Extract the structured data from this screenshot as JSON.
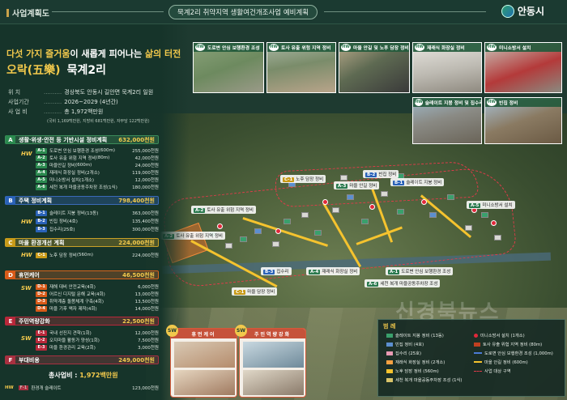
{
  "header": {
    "section": "사업계획도",
    "badge": "묵계2리 취약지역 생활여건개조사업 예비계획",
    "logo_text": "안동시"
  },
  "headline": {
    "line1_pre": "다섯 가지 즐거움",
    "line1_mid": "이 새롭게 피어나는 ",
    "line1_em": "삶의 터전",
    "orak": "오락(五樂)",
    "village": "묵계2리"
  },
  "project_info": [
    {
      "key": "위 치",
      "value": "경상북도 안동시 길안면 묵계2리 일원"
    },
    {
      "key": "사업기간",
      "value": "2026~2029 (4년간)"
    },
    {
      "key": "사 업 비",
      "value": "총 1,972백만원"
    }
  ],
  "funding_note": "(국비 1,169백만원, 지방비 681백만원, 자부담 122백만원)",
  "categories": [
    {
      "code": "A",
      "name": "생활·위생·안전 등 기반시설 정비계획",
      "amount": "632,000천원"
    },
    {
      "code": "B",
      "name": "주택 정비계획",
      "amount": "798,400천원"
    },
    {
      "code": "C",
      "name": "마을 환경개선 계획",
      "amount": "224,000천원"
    },
    {
      "code": "D",
      "name": "휴먼케어",
      "amount": "46,500천원"
    },
    {
      "code": "E",
      "name": "주민역량강화",
      "amount": "22,500천원"
    },
    {
      "code": "F",
      "name": "부대비용",
      "amount": "249,000천원"
    }
  ],
  "items_a": [
    {
      "code": "A-1",
      "name": "도로변 안심 보행환경 조성",
      "unit": "(600m)",
      "amount": "255,000천원"
    },
    {
      "code": "A-2",
      "name": "토사 유출 위험 지역 정비",
      "unit": "(80m)",
      "amount": "42,000천원"
    },
    {
      "code": "A-3",
      "name": "마을안길 정비",
      "unit": "(600m)",
      "amount": "24,000천원"
    },
    {
      "code": "A-4",
      "name": "재래식 화장실 정비",
      "unit": "(2개소)",
      "amount": "119,000천원"
    },
    {
      "code": "A-5",
      "name": "미니소방서 설치",
      "unit": "(1개소)",
      "amount": "12,000천원"
    },
    {
      "code": "A-6",
      "name": "세천 복개 마을공동주차장 조성",
      "unit": "(1식)",
      "amount": "180,000천원"
    }
  ],
  "items_b": [
    {
      "code": "B-1",
      "name": "슬레이트 지붕 정비",
      "unit": "(13동)",
      "amount": "363,000천원"
    },
    {
      "code": "B-2",
      "name": "빈집 정비",
      "unit": "(4호)",
      "amount": "135,400천원"
    },
    {
      "code": "B-3",
      "name": "집수리",
      "unit": "(25호)",
      "amount": "300,000천원"
    }
  ],
  "items_c": [
    {
      "code": "C-1",
      "name": "노후 담장 정비",
      "unit": "(560m)",
      "amount": "224,000천원"
    }
  ],
  "items_d": [
    {
      "code": "D-1",
      "name": "재해 대비 안전교육",
      "unit": "(4회)",
      "amount": "6,000천원"
    },
    {
      "code": "D-2",
      "name": "어르신 디지털 문해 교육",
      "unit": "(4회)",
      "amount": "13,000천원"
    },
    {
      "code": "D-3",
      "name": "취약계층 돌봄체계 구축",
      "unit": "(4회)",
      "amount": "13,500천원"
    },
    {
      "code": "D-4",
      "name": "마을 기후 액자 제작",
      "unit": "(4회)",
      "amount": "14,000천원"
    }
  ],
  "items_e": [
    {
      "code": "E-1",
      "name": "국내 선진지 견학",
      "unit": "(1회)",
      "amount": "12,000천원"
    },
    {
      "code": "E-2",
      "name": "오지마을 활동가 양성",
      "unit": "(1회)",
      "amount": "7,500천원"
    },
    {
      "code": "E-3",
      "name": "마을 환경관리 교육",
      "unit": "(2회)",
      "amount": "3,000천원"
    }
  ],
  "total_label": "총사업비 : ",
  "total_value": "1,972백만원",
  "extra_row": {
    "tag": "HW",
    "code": "F-1",
    "name": "환경개 슬레이트",
    "amount": "123,000천원"
  },
  "side_tags": {
    "hw": "HW",
    "sw": "SW"
  },
  "photos": [
    {
      "tag": "HW",
      "label": "도로변 안심 보행환경 조성"
    },
    {
      "tag": "HW",
      "label": "토사 유출 위험 지역 정비"
    },
    {
      "tag": "HW",
      "label": "마을 안길 및 노후 담장 정비"
    },
    {
      "tag": "HW",
      "label": "재래식 화장실 정비"
    },
    {
      "tag": "HW",
      "label": "미니소방서 설치"
    },
    {
      "tag": "HW",
      "label": "슬레이트 지붕 정비 및 집수리"
    },
    {
      "tag": "HW",
      "label": "빈집 정비"
    }
  ],
  "sw_boxes": [
    {
      "tag": "SW",
      "label": "휴먼케어"
    },
    {
      "tag": "SW",
      "label": "주민역량강화"
    }
  ],
  "map_labels": {
    "a1": "도로변 안심 보행환경 조성",
    "a2_top": "토사 유출 위험 지역 정비",
    "a2_left": "토사 유출 위험 지역 정비",
    "a3": "마을 안길 정비",
    "a4": "재래식 화장실 정비",
    "a5": "미니소방서 설치",
    "a6": "세천 복개 마을공동주차장 조성",
    "b1": "슬레이트 지붕 정비",
    "b2": "빈집 정비",
    "b3": "집수리",
    "c1": "노후 담장 정비",
    "c1b": "노후 담장 정비",
    "c1c": "마을 담장 정비",
    "road": "마을 안길 정비"
  },
  "map_codes": {
    "a1": "A-1",
    "a2": "A-2",
    "a3": "A-3",
    "a4": "A-4",
    "a5": "A-5",
    "a6": "A-6",
    "b1": "B-1",
    "b2": "B-2",
    "b3": "B-3",
    "c1": "C-1"
  },
  "legend": {
    "title": "범 례",
    "items": [
      {
        "label": "슬레이트 지붕 정비 (13동)",
        "color": "#3aa06c"
      },
      {
        "label": "빈집 정비 (4호)",
        "color": "#5c8fd0"
      },
      {
        "label": "집수리 (25호)",
        "color": "#e89ab4"
      },
      {
        "label": "재래식 화장실 정비 (2개소)",
        "color": "#f5a142"
      },
      {
        "label": "노후 담장 정비 (560m)",
        "color": "#f5c32e"
      },
      {
        "label": "세천 복개 마을공동주차장 조성 (1식)",
        "color": "#d9c46a"
      },
      {
        "label": "미니소방서 설치 (1개소)",
        "color": "#e0283a"
      },
      {
        "label": "토사 유출 위험 지역 정비 (80m)",
        "color": "#c04020"
      },
      {
        "label": "도로변 안심 보행환경 조성 (1,000m)",
        "color": "#4b7bd6"
      },
      {
        "label": "마을 안길 정비 (600m)",
        "color": "#f5c32e"
      },
      {
        "label": "사업 대상 구역",
        "color": "#e23b4a"
      }
    ]
  },
  "watermark": "신경북뉴스"
}
